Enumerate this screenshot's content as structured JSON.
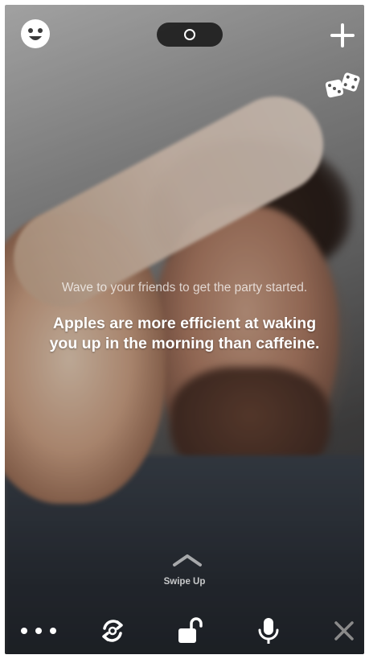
{
  "top_bar": {
    "left_icon": "smiley-face-icon",
    "center_toggle_icon": "record-toggle-icon",
    "right_icon": "plus-icon",
    "dice_icon": "dice-icon"
  },
  "overlay": {
    "wave_message": "Wave to your friends to get the party started.",
    "fact_line_1": "Apples are more efficient at waking",
    "fact_line_2": "you up in the morning than caffeine."
  },
  "swipe": {
    "icon": "chevron-up-icon",
    "label": "Swipe Up"
  },
  "bottom_bar": {
    "items": [
      {
        "icon": "more-options-icon"
      },
      {
        "icon": "camera-flip-icon"
      },
      {
        "icon": "unlocked-lock-icon"
      },
      {
        "icon": "microphone-icon"
      },
      {
        "icon": "close-icon"
      }
    ]
  },
  "colors": {
    "icon": "#ffffff",
    "toggle_bg": "#141414",
    "close_icon": "#8a8a8a"
  }
}
